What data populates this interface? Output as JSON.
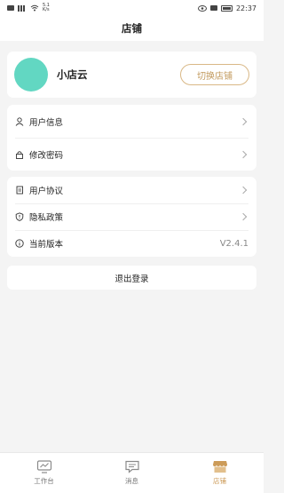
{
  "status_bar": {
    "speed_top": "5.1",
    "speed_bottom": "K/s",
    "time": "22:37"
  },
  "header": {
    "title": "店铺"
  },
  "profile": {
    "name": "小店云",
    "switch_label": "切换店铺",
    "avatar_color": "#62d7c2"
  },
  "account": [
    {
      "label": "用户信息",
      "icon": "user-icon"
    },
    {
      "label": "修改密码",
      "icon": "lock-icon"
    }
  ],
  "info": [
    {
      "label": "用户协议",
      "icon": "document-icon"
    },
    {
      "label": "隐私政策",
      "icon": "shield-icon"
    },
    {
      "label": "当前版本",
      "icon": "info-icon",
      "value": "V2.4.1"
    }
  ],
  "logout_label": "退出登录",
  "tabs": [
    {
      "label": "工作台",
      "icon": "workbench-icon",
      "active": false
    },
    {
      "label": "消息",
      "icon": "message-icon",
      "active": false
    },
    {
      "label": "店铺",
      "icon": "shop-icon",
      "active": true
    }
  ],
  "colors": {
    "accent": "#cc9b58",
    "background": "#f4f4f4"
  }
}
